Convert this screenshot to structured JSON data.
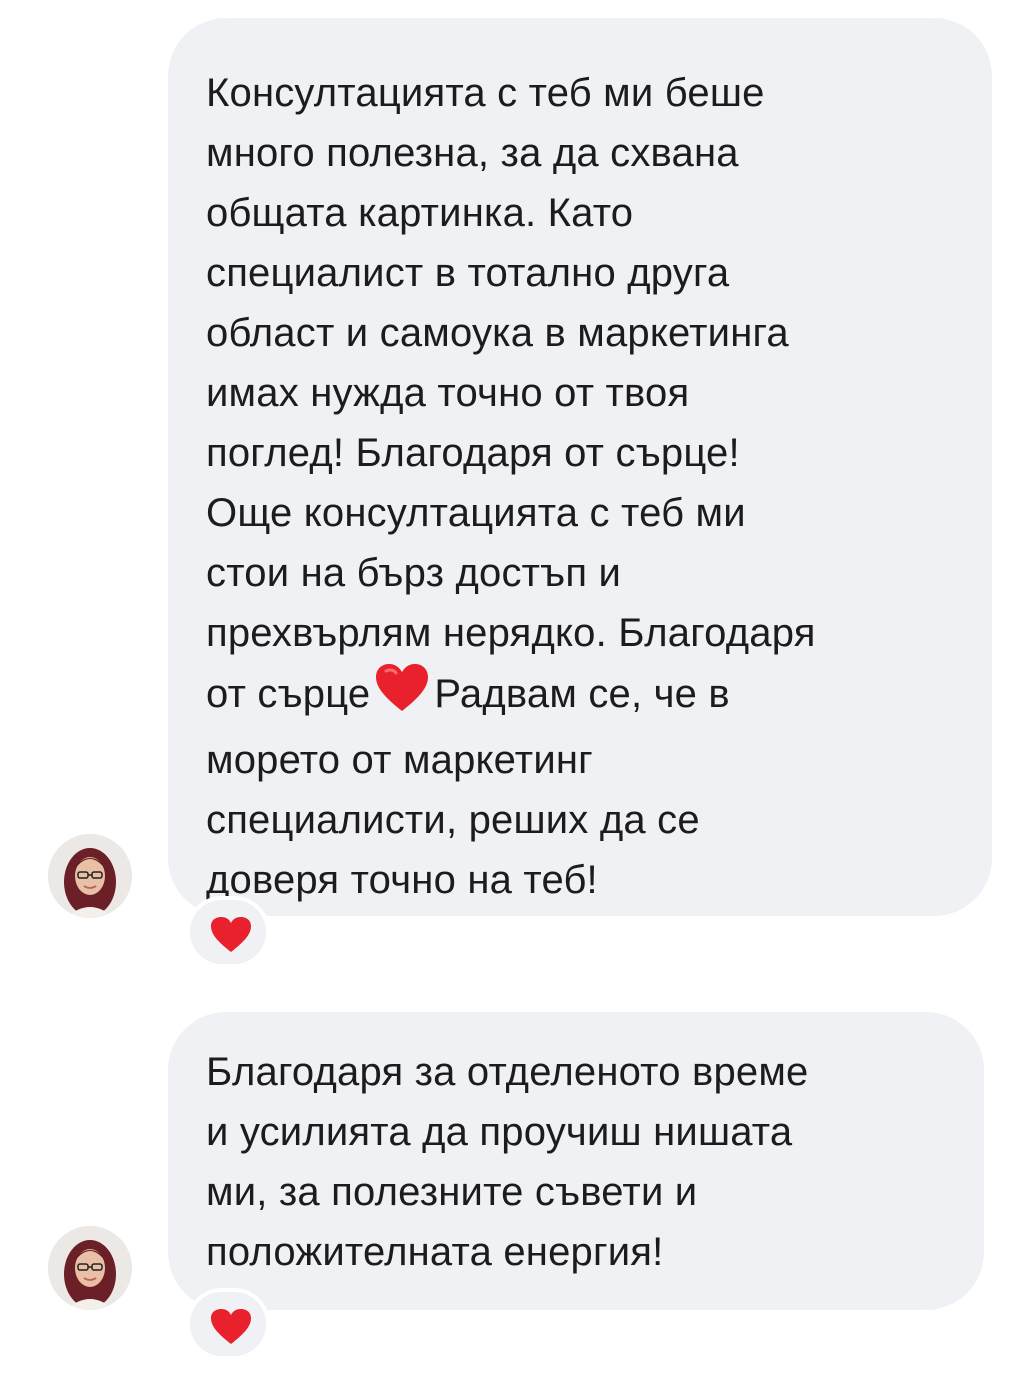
{
  "messages": [
    {
      "text_before_heart": "Консултацията с теб ми беше\nмного полезна, за да схвана\nобщата картинка. Като\nспециалист в тотално друга\nобласт и самоука в маркетинга\nимах нужда точно от твоя\nпоглед! Благодаря от сърце!\nОще консултацията с теб ми\nстои на бърз достъп и\nпрехвърлям нерядко. Благодаря\nот сърце",
      "inline_emoji": "red-heart",
      "text_after_heart": "Радвам се, че в\nморето от маркетинг\nспециалисти, реших да се\nдоверя точно на теб!",
      "reaction": "red-heart"
    },
    {
      "text": "Благодаря за отделеното време\nи усилията да проучиш нишата\nми, за полезните съвети и\nположителната енергия!",
      "reaction": "red-heart"
    }
  ],
  "colors": {
    "bubble_bg": "#eff1f4",
    "heart": "#e8212c",
    "text": "#1c1c1e"
  }
}
